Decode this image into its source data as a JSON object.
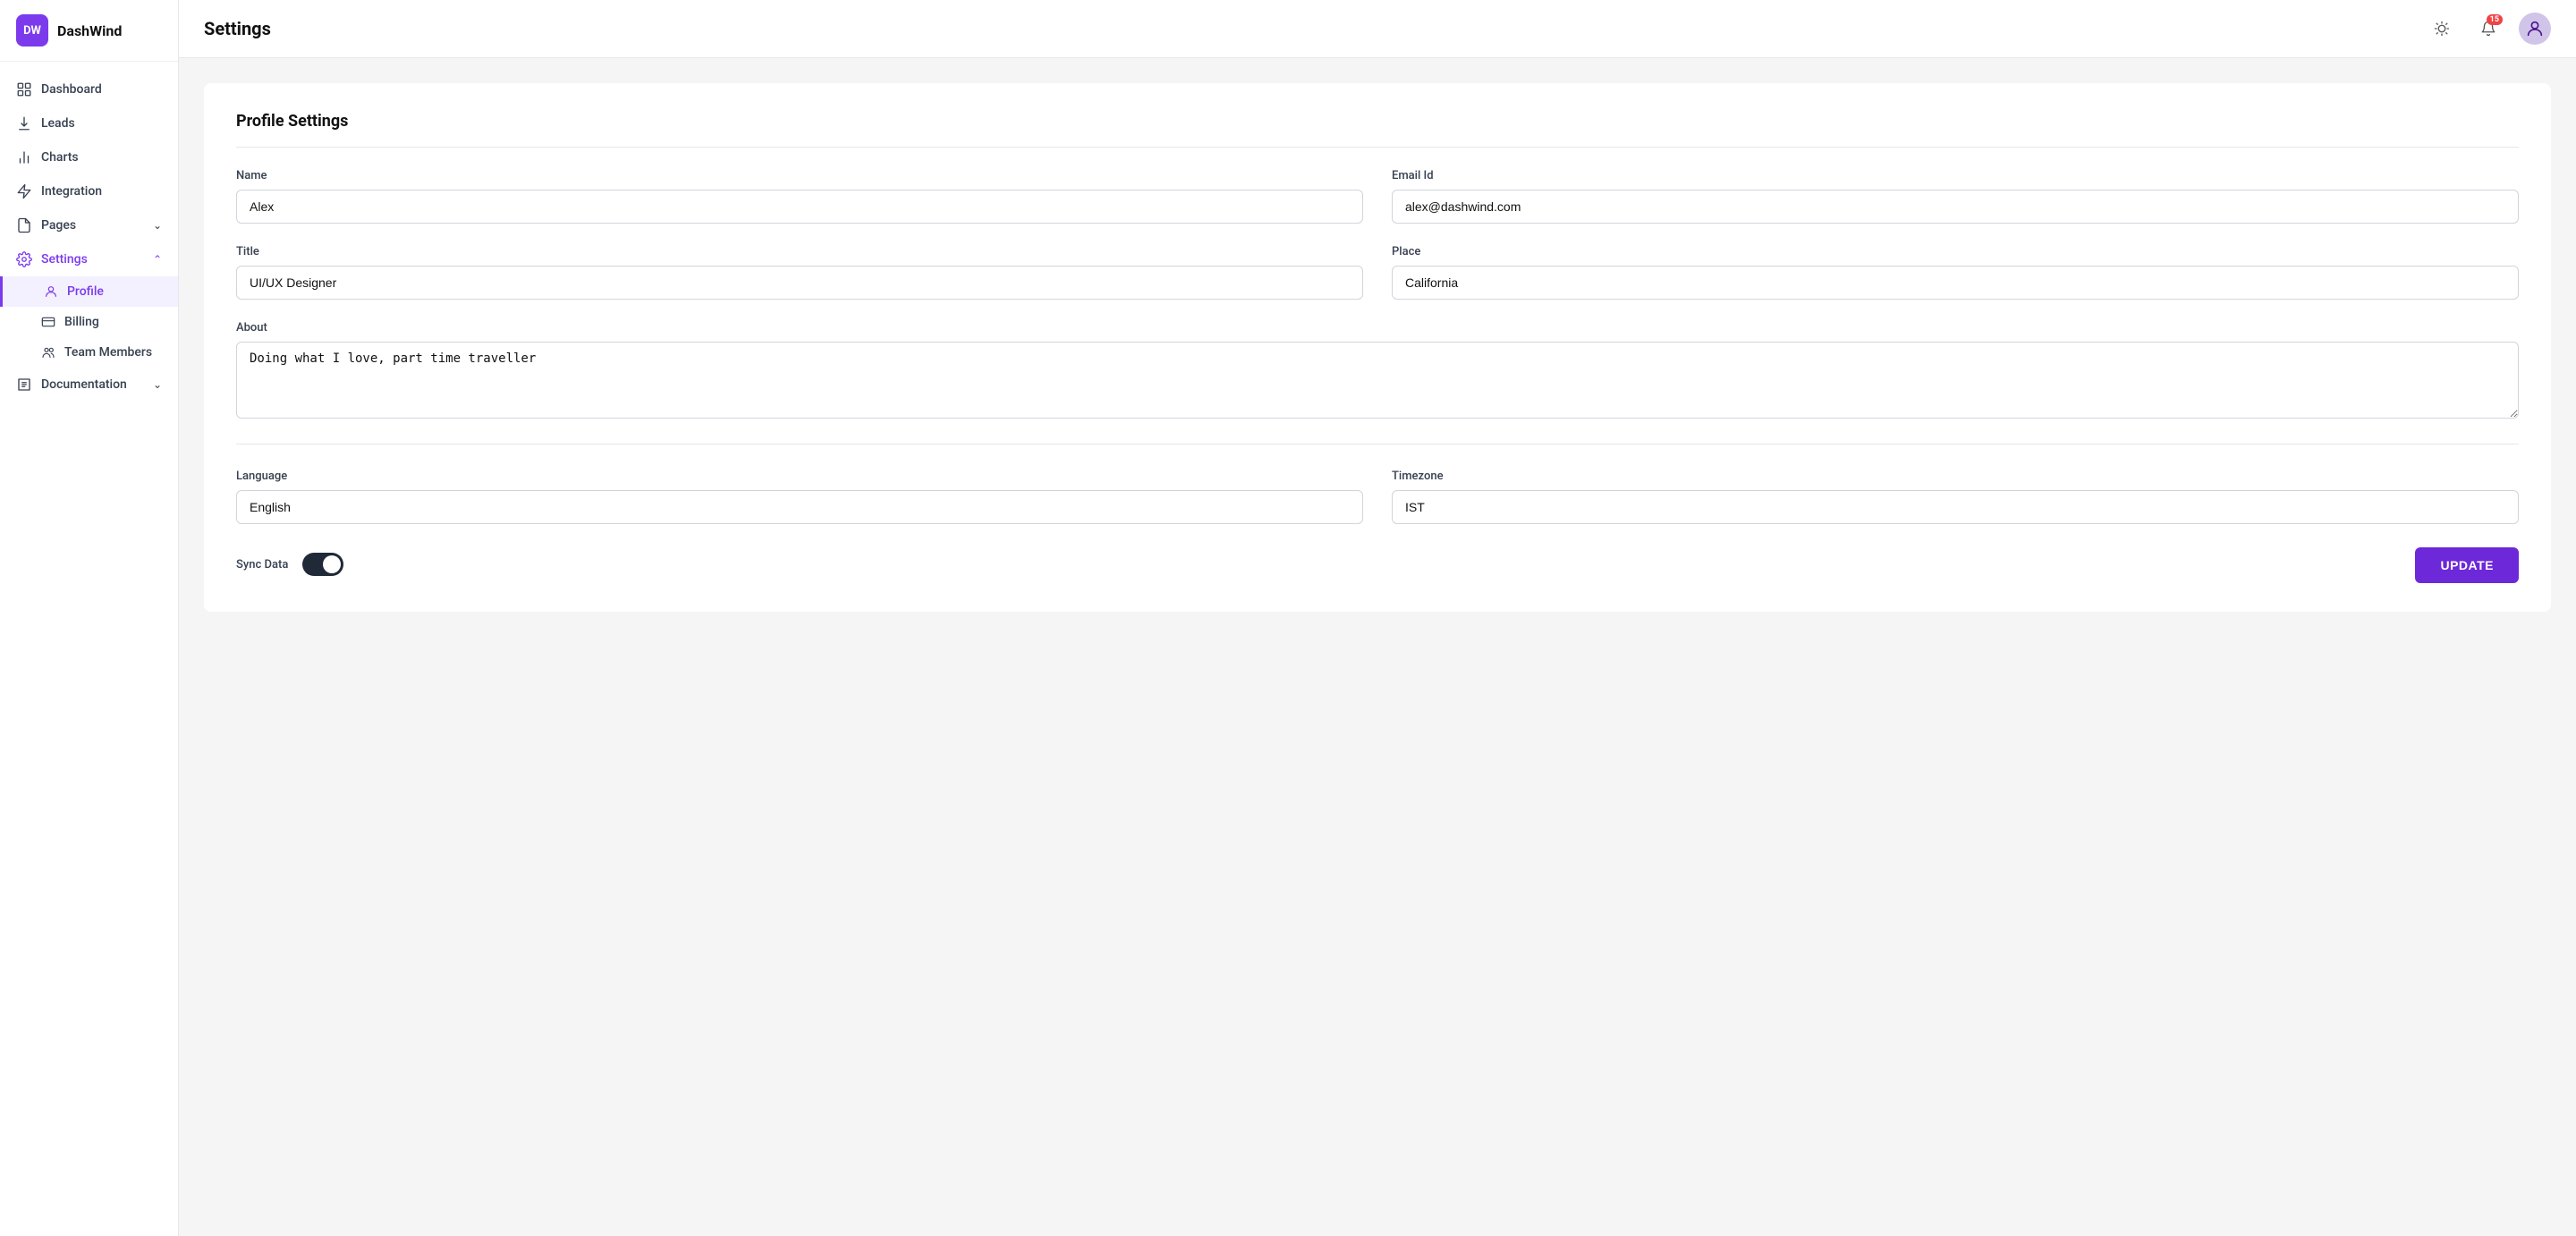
{
  "app": {
    "name": "DashWind",
    "logo_initials": "DW"
  },
  "header": {
    "title": "Settings",
    "notification_count": "15"
  },
  "sidebar": {
    "nav_items": [
      {
        "id": "dashboard",
        "label": "Dashboard",
        "icon": "grid-icon"
      },
      {
        "id": "leads",
        "label": "Leads",
        "icon": "download-icon"
      },
      {
        "id": "charts",
        "label": "Charts",
        "icon": "bar-chart-icon"
      },
      {
        "id": "integration",
        "label": "Integration",
        "icon": "lightning-icon"
      },
      {
        "id": "pages",
        "label": "Pages",
        "icon": "file-icon",
        "has_chevron": true
      },
      {
        "id": "settings",
        "label": "Settings",
        "icon": "gear-icon",
        "has_chevron": true,
        "active": true
      }
    ],
    "sub_items_settings": [
      {
        "id": "profile",
        "label": "Profile",
        "icon": "user-icon",
        "active": true
      },
      {
        "id": "billing",
        "label": "Billing",
        "icon": "card-icon"
      },
      {
        "id": "team-members",
        "label": "Team Members",
        "icon": "users-icon"
      }
    ],
    "nav_items_bottom": [
      {
        "id": "documentation",
        "label": "Documentation",
        "icon": "doc-icon",
        "has_chevron": true
      }
    ]
  },
  "profile_settings": {
    "section_title": "Profile Settings",
    "fields": {
      "name_label": "Name",
      "name_value": "Alex",
      "email_label": "Email Id",
      "email_value": "alex@dashwind.com",
      "title_label": "Title",
      "title_value": "UI/UX Designer",
      "place_label": "Place",
      "place_value": "California",
      "about_label": "About",
      "about_value": "Doing what I love, part time traveller",
      "language_label": "Language",
      "language_value": "English",
      "timezone_label": "Timezone",
      "timezone_value": "IST",
      "sync_data_label": "Sync Data"
    },
    "update_button": "UPDATE"
  }
}
